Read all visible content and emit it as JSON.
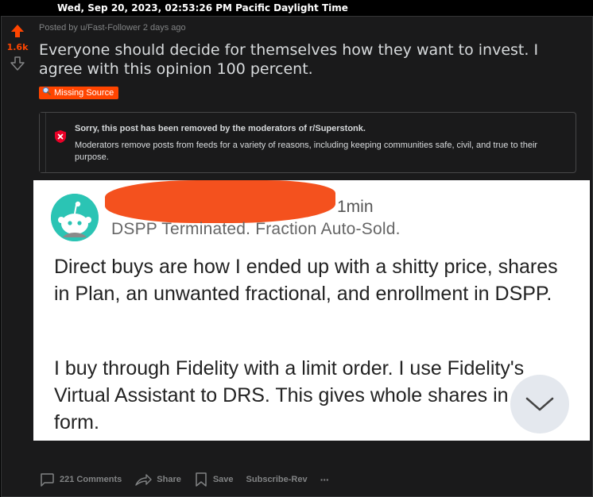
{
  "timestamp": "Wed, Sep 20, 2023, 02:53:26 PM Pacific Daylight Time",
  "post": {
    "vote_count": "1.6k",
    "posted_by": "Posted by u/Fast-Follower 2 days ago",
    "title": "Everyone should decide for themselves how they want to invest. I agree with this opinion 100 percent.",
    "flair": "Missing Source"
  },
  "removed_notice": {
    "title": "Sorry, this post has been removed by the moderators of r/Superstonk.",
    "body": "Moderators remove posts from feeds for a variety of reasons, including keeping communities safe, civil, and true to their purpose."
  },
  "screenshot": {
    "time": "1min",
    "subtitle": "DSPP Terminated. Fraction Auto-Sold.",
    "paragraph1": "Direct buys are how I ended up with a shitty price, shares in Plan, an unwanted fractional, and enrollment in DSPP.",
    "paragraph2": "I buy through Fidelity with a limit order. I use Fidelity's Virtual Assistant to DRS. This gives whole shares in Book form."
  },
  "actions": {
    "comments": "221 Comments",
    "share": "Share",
    "save": "Save",
    "subscribe": "Subscribe-Rev",
    "more": "···"
  },
  "colors": {
    "upvote": "#ff4500",
    "flair_bg": "#ff4500",
    "removed_icon": "#ea0027",
    "avatar": "#2bc4b4",
    "redaction": "#f4511e"
  }
}
